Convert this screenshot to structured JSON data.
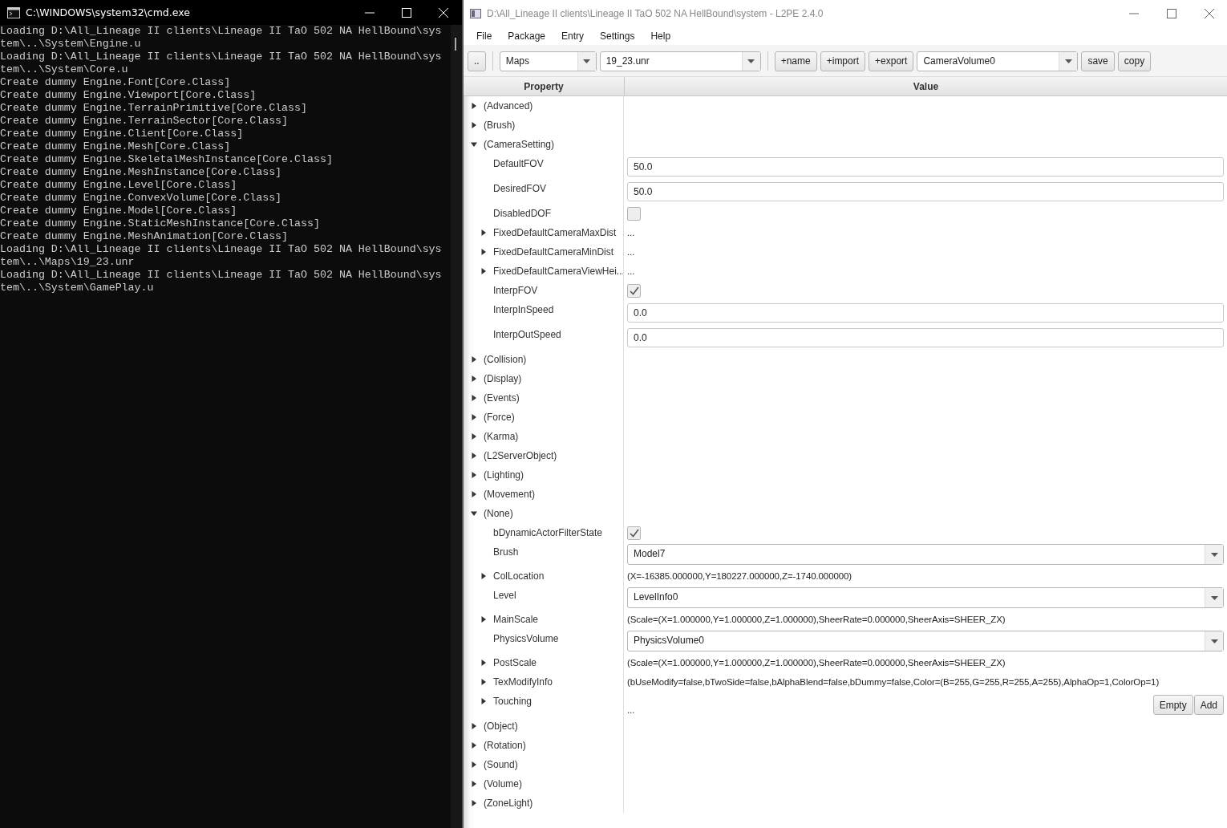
{
  "console": {
    "title": "C:\\WINDOWS\\system32\\cmd.exe",
    "lines": [
      "Loading D:\\All_Lineage II clients\\Lineage II TaO 502 NA HellBound\\sys",
      "tem\\..\\System\\Engine.u",
      "Loading D:\\All_Lineage II clients\\Lineage II TaO 502 NA HellBound\\sys",
      "tem\\..\\System\\Core.u",
      "Create dummy Engine.Font[Core.Class]",
      "Create dummy Engine.Viewport[Core.Class]",
      "Create dummy Engine.TerrainPrimitive[Core.Class]",
      "Create dummy Engine.TerrainSector[Core.Class]",
      "Create dummy Engine.Client[Core.Class]",
      "Create dummy Engine.Mesh[Core.Class]",
      "Create dummy Engine.SkeletalMeshInstance[Core.Class]",
      "Create dummy Engine.MeshInstance[Core.Class]",
      "Create dummy Engine.Level[Core.Class]",
      "Create dummy Engine.ConvexVolume[Core.Class]",
      "Create dummy Engine.Model[Core.Class]",
      "Create dummy Engine.StaticMeshInstance[Core.Class]",
      "Create dummy Engine.MeshAnimation[Core.Class]",
      "Loading D:\\All_Lineage II clients\\Lineage II TaO 502 NA HellBound\\sys",
      "tem\\..\\Maps\\19_23.unr",
      "Loading D:\\All_Lineage II clients\\Lineage II TaO 502 NA HellBound\\sys",
      "tem\\..\\System\\GamePlay.u"
    ]
  },
  "editor": {
    "title": "D:\\All_Lineage II clients\\Lineage II TaO 502 NA HellBound\\system - L2PE 2.4.0",
    "menu": [
      "File",
      "Package",
      "Entry",
      "Settings",
      "Help"
    ],
    "toolbar": [
      {
        "kind": "button",
        "label": ".."
      },
      {
        "kind": "separator"
      },
      {
        "kind": "combo",
        "value": "Maps"
      },
      {
        "kind": "combo",
        "value": "19_23.unr"
      },
      {
        "kind": "separator"
      },
      {
        "kind": "button",
        "label": "+name"
      },
      {
        "kind": "button",
        "label": "+import"
      },
      {
        "kind": "button",
        "label": "+export"
      },
      {
        "kind": "combo",
        "value": "CameraVolume0"
      },
      {
        "kind": "button",
        "label": "save"
      },
      {
        "kind": "button",
        "label": "copy"
      }
    ],
    "columns": [
      "Property",
      "Value"
    ],
    "properties": [
      {
        "name": "(Advanced)",
        "expanded": false
      },
      {
        "name": "(Brush)",
        "expanded": false
      },
      {
        "name": "(CameraSetting)",
        "expanded": true,
        "children": [
          {
            "name": "DefaultFOV",
            "kind": "field",
            "value": "50.0"
          },
          {
            "name": "DesiredFOV",
            "kind": "field",
            "value": "50.0"
          },
          {
            "name": "DisabledDOF",
            "kind": "checkbox",
            "checked": false
          },
          {
            "name": "FixedDefaultCameraMaxDist",
            "kind": "text",
            "value": "...",
            "expanded": false
          },
          {
            "name": "FixedDefaultCameraMinDist",
            "kind": "text",
            "value": "...",
            "expanded": false
          },
          {
            "name": "FixedDefaultCameraViewHei...",
            "kind": "text",
            "value": "...",
            "expanded": false
          },
          {
            "name": "InterpFOV",
            "kind": "checkbox",
            "checked": true
          },
          {
            "name": "InterpInSpeed",
            "kind": "field",
            "value": "0.0"
          },
          {
            "name": "InterpOutSpeed",
            "kind": "field",
            "value": "0.0"
          }
        ]
      },
      {
        "name": "(Collision)",
        "expanded": false
      },
      {
        "name": "(Display)",
        "expanded": false
      },
      {
        "name": "(Events)",
        "expanded": false
      },
      {
        "name": "(Force)",
        "expanded": false
      },
      {
        "name": "(Karma)",
        "expanded": false
      },
      {
        "name": "(L2ServerObject)",
        "expanded": false
      },
      {
        "name": "(Lighting)",
        "expanded": false
      },
      {
        "name": "(Movement)",
        "expanded": false
      },
      {
        "name": "(None)",
        "expanded": true,
        "children": [
          {
            "name": "bDynamicActorFilterState",
            "kind": "checkbox",
            "checked": true
          },
          {
            "name": "Brush",
            "kind": "combo",
            "value": "Model7"
          },
          {
            "name": "ColLocation",
            "kind": "text",
            "value": "(X=-16385.000000,Y=180227.000000,Z=-1740.000000)",
            "expanded": false
          },
          {
            "name": "Level",
            "kind": "combo",
            "value": "LevelInfo0"
          },
          {
            "name": "MainScale",
            "kind": "text",
            "value": "(Scale=(X=1.000000,Y=1.000000,Z=1.000000),SheerRate=0.000000,SheerAxis=SHEER_ZX)",
            "expanded": false
          },
          {
            "name": "PhysicsVolume",
            "kind": "combo",
            "value": "PhysicsVolume0"
          },
          {
            "name": "PostScale",
            "kind": "text",
            "value": "(Scale=(X=1.000000,Y=1.000000,Z=1.000000),SheerRate=0.000000,SheerAxis=SHEER_ZX)",
            "expanded": false
          },
          {
            "name": "TexModifyInfo",
            "kind": "text",
            "value": "(bUseModify=false,bTwoSide=false,bAlphaBlend=false,bDummy=false,Color=(B=255,G=255,R=255,A=255),AlphaOp=1,ColorOp=1)",
            "expanded": false
          },
          {
            "name": "Touching",
            "kind": "list",
            "value": "...",
            "buttons": [
              "Empty",
              "Add"
            ],
            "expanded": false
          }
        ]
      },
      {
        "name": "(Object)",
        "expanded": false
      },
      {
        "name": "(Rotation)",
        "expanded": false
      },
      {
        "name": "(Sound)",
        "expanded": false
      },
      {
        "name": "(Volume)",
        "expanded": false
      },
      {
        "name": "(ZoneLight)",
        "expanded": false
      }
    ]
  }
}
